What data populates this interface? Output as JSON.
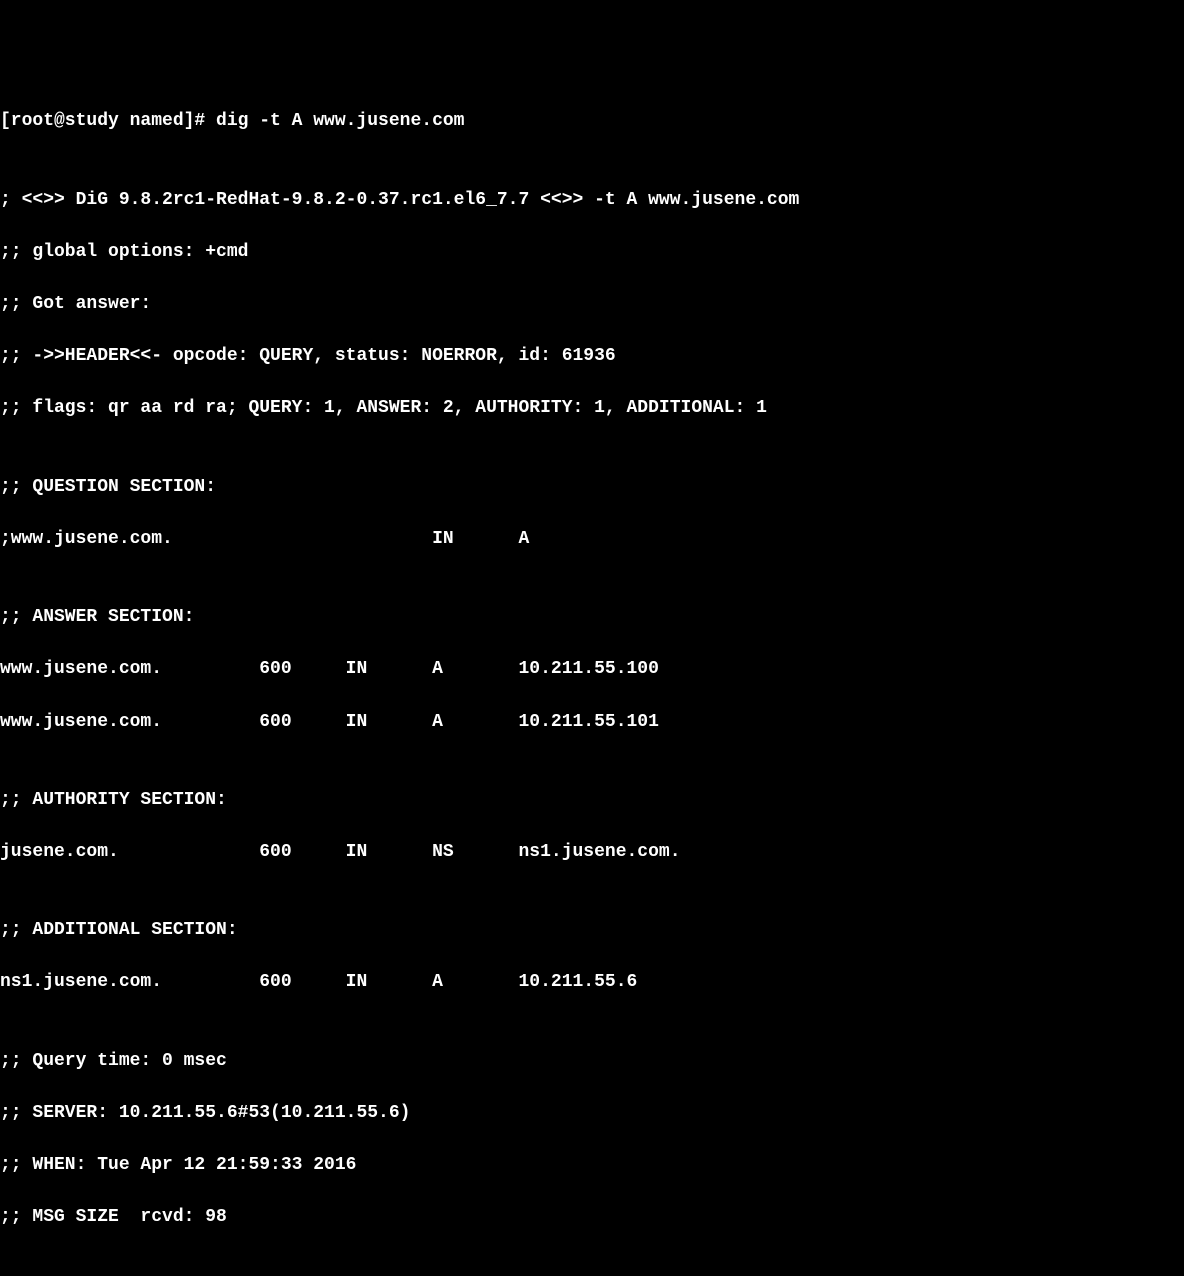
{
  "prompt": "[root@study named]# dig -t A www.jusene.com",
  "blank1": "",
  "version": "; <<>> DiG 9.8.2rc1-RedHat-9.8.2-0.37.rc1.el6_7.7 <<>> -t A www.jusene.com",
  "global_options": ";; global options: +cmd",
  "got_answer": ";; Got answer:",
  "header": ";; ->>HEADER<<- opcode: QUERY, status: NOERROR, id: 61936",
  "flags": ";; flags: qr aa rd ra; QUERY: 1, ANSWER: 2, AUTHORITY: 1, ADDITIONAL: 1",
  "blank2": "",
  "question_header": ";; QUESTION SECTION:",
  "question_1": ";www.jusene.com.                        IN      A",
  "blank3": "",
  "answer_header": ";; ANSWER SECTION:",
  "answer_1": "www.jusene.com.         600     IN      A       10.211.55.100",
  "answer_2": "www.jusene.com.         600     IN      A       10.211.55.101",
  "blank4": "",
  "authority_header": ";; AUTHORITY SECTION:",
  "authority_1": "jusene.com.             600     IN      NS      ns1.jusene.com.",
  "blank5": "",
  "additional_header": ";; ADDITIONAL SECTION:",
  "additional_1": "ns1.jusene.com.         600     IN      A       10.211.55.6",
  "blank6": "",
  "query_time": ";; Query time: 0 msec",
  "server": ";; SERVER: 10.211.55.6#53(10.211.55.6)",
  "when": ";; WHEN: Tue Apr 12 21:59:33 2016",
  "msg_size": ";; MSG SIZE  rcvd: 98"
}
